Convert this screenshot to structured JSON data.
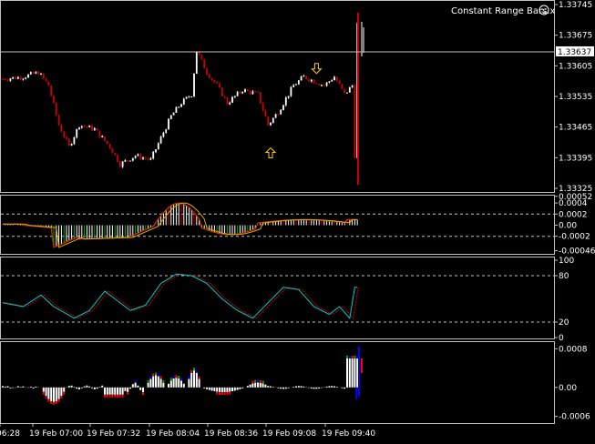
{
  "chart_data": [
    {
      "type": "candlestick",
      "name": "main",
      "title": "Constant Range Bars.x",
      "ylim": [
        1.33325,
        1.33745
      ],
      "yticks": [
        "1.33745",
        "1.33675",
        "1.33605",
        "1.33535",
        "1.33465",
        "1.33395",
        "1.33325"
      ],
      "ytick_values": [
        1.33745,
        1.33675,
        1.33605,
        1.33535,
        1.33465,
        1.33395,
        1.33325
      ],
      "current_price": "1.33637",
      "current_value": 1.33637,
      "colors": {
        "up": "#ffffff",
        "down": "#cc0000",
        "price_line": "#c0c0c0",
        "tag_bg": "#ffffff",
        "tag_text": "#000000"
      },
      "markers": [
        {
          "type": "up-arrow",
          "index": 105,
          "value": 1.33405,
          "color": "#ffcc00"
        },
        {
          "type": "down-arrow",
          "index": 123,
          "value": 1.336,
          "color": "#ffcc00"
        }
      ],
      "x": [
        "06:28",
        "07:00",
        "07:32",
        "08:04",
        "08:36",
        "09:08",
        "09:40"
      ],
      "xticks": [
        "06:28",
        "19 Feb 07:00",
        "19 Feb 07:32",
        "19 Feb 08:04",
        "19 Feb 08:36",
        "19 Feb 09:08",
        "19 Feb 09:40"
      ]
    },
    {
      "type": "histogram",
      "name": "macd",
      "ylim": [
        -0.0005,
        0.0005
      ],
      "yticks": [
        "0.0004",
        "0.00052",
        "0.0002",
        "0.00",
        "-0.0002",
        "-0.00046"
      ],
      "ytick_values": [
        0.0004,
        0.00052,
        0.0002,
        0.0,
        -0.0002,
        -0.00046
      ],
      "levels": [
        0.0002,
        -0.0002
      ],
      "colors": {
        "hist_pos": "#ffffff",
        "hist_neg": "#ffffff",
        "hist_green": "#00aa00",
        "hist_red": "#cc0000",
        "line": "#cc3300",
        "signal": "#ddaa00"
      }
    },
    {
      "type": "line",
      "name": "stochastic",
      "ylim": [
        0,
        100
      ],
      "yticks": [
        "100",
        "80",
        "20",
        "0"
      ],
      "ytick_values": [
        100,
        80,
        20,
        0
      ],
      "levels": [
        80,
        20
      ],
      "colors": {
        "main": "#00cccc",
        "signal": "#cc0000"
      }
    },
    {
      "type": "histogram",
      "name": "oscillator",
      "ylim": [
        -0.0007,
        0.0009
      ],
      "yticks": [
        "0.0008",
        "0.00",
        "-0.0006"
      ],
      "ytick_values": [
        0.0008,
        0.0,
        -0.0006
      ],
      "colors": {
        "white": "#ffffff",
        "red": "#ff0000",
        "blue": "#0000ff",
        "green": "#00aa00"
      }
    }
  ]
}
